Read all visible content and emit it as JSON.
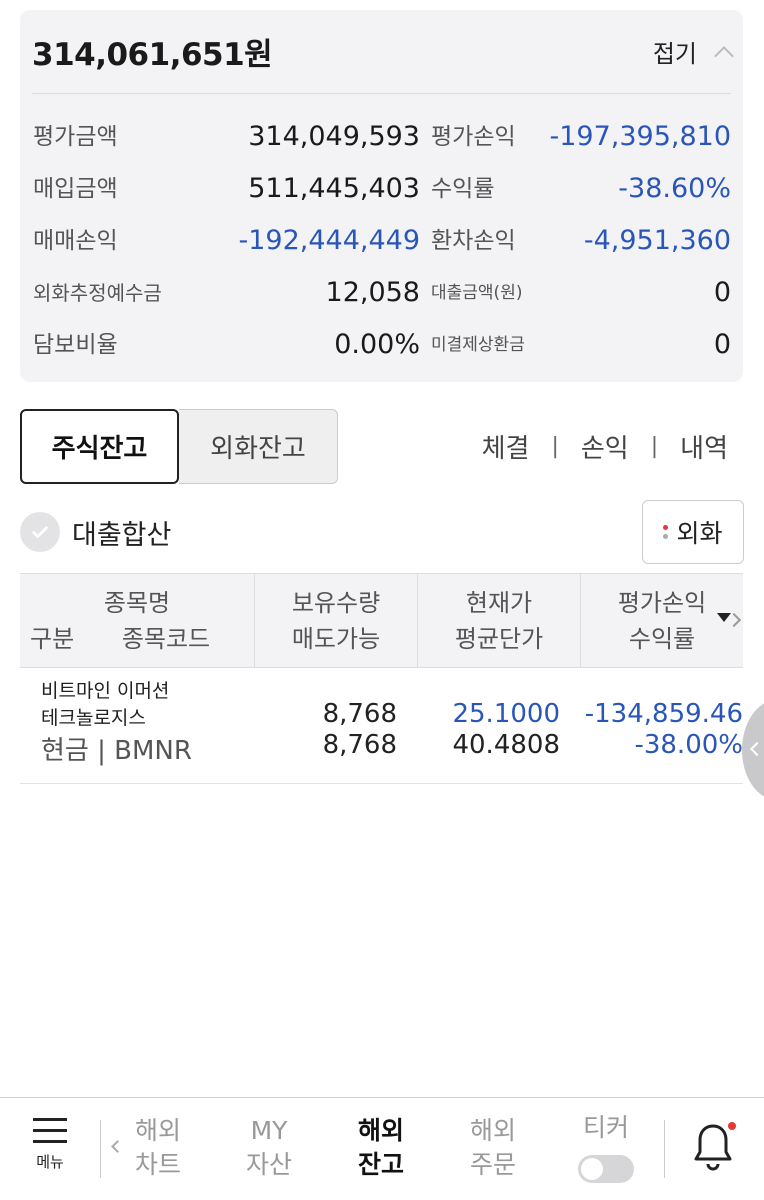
{
  "summary": {
    "total": "314,061,651원",
    "fold_label": "접기",
    "rows": [
      {
        "label1": "평가금액",
        "value1": "314,049,593",
        "label2": "평가손익",
        "value2": "-197,395,810"
      },
      {
        "label1": "매입금액",
        "value1": "511,445,403",
        "label2": "수익률",
        "value2": "-38.60%"
      },
      {
        "label1": "매매손익",
        "value1": "-192,444,449",
        "label2": "환차손익",
        "value2": "-4,951,360"
      },
      {
        "label1": "외화추정예수금",
        "value1": "12,058",
        "label2": "대출금액(원)",
        "value2": "0"
      },
      {
        "label1": "담보비율",
        "value1": "0.00%",
        "label2": "미결제상환금",
        "value2": "0"
      }
    ]
  },
  "tabs": {
    "stock": "주식잔고",
    "fx": "외화잔고"
  },
  "links": [
    "체결",
    "손익",
    "내역"
  ],
  "loan_sum": {
    "label": "대출합산"
  },
  "fx_button": {
    "label": "외화"
  },
  "table": {
    "headers": [
      {
        "top": "종목명",
        "bottom_left": "구분",
        "bottom_right": "종목코드"
      },
      {
        "top": "보유수량",
        "bottom": "매도가능"
      },
      {
        "top": "현재가",
        "bottom": "평균단가"
      },
      {
        "top": "평가손익",
        "bottom": "수익률"
      }
    ],
    "rows": [
      {
        "name_line1": "비트마인 이머션",
        "name_line2": "테크놀로지스",
        "type_code": "현금 | BMNR",
        "qty": "8,768",
        "sellable": "8,768",
        "price": "25.1000",
        "avg_price": "40.4808",
        "pnl": "-134,859.46",
        "return_rate": "-38.00%"
      }
    ]
  },
  "nav": {
    "menu": "메뉴",
    "items": [
      {
        "line1": "해외",
        "line2": "차트"
      },
      {
        "line1": "MY",
        "line2": "자산"
      },
      {
        "line1": "해외",
        "line2": "잔고"
      },
      {
        "line1": "해외",
        "line2": "주문"
      }
    ],
    "ticker": "티커"
  },
  "colors": {
    "negative": "#2a56b8",
    "badge": "#e53935"
  }
}
